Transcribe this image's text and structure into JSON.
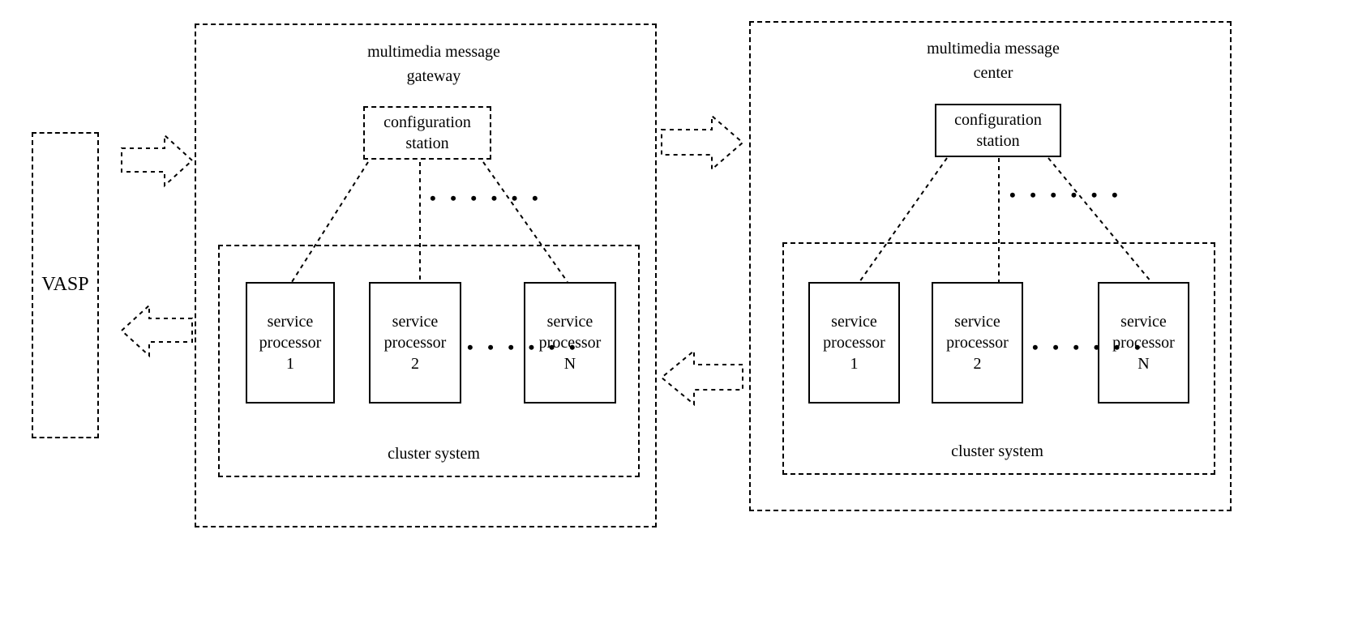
{
  "vasp": {
    "label": "VASP"
  },
  "gateway": {
    "title_line1": "multimedia message",
    "title_line2": "gateway",
    "config": {
      "line1": "configuration",
      "line2": "station"
    },
    "cluster": {
      "label": "cluster system",
      "proc1": "service\nprocessor\n1",
      "proc2": "service\nprocessor\n2",
      "procN": "service\nprocessor\nN"
    }
  },
  "center": {
    "title_line1": "multimedia message",
    "title_line2": "center",
    "config": {
      "line1": "configuration",
      "line2": "station"
    },
    "cluster": {
      "label": "cluster system",
      "proc1": "service\nprocessor\n1",
      "proc2": "service\nprocessor\n2",
      "procN": "service\nprocessor\nN"
    }
  },
  "ellipsis": "• • • • • •"
}
